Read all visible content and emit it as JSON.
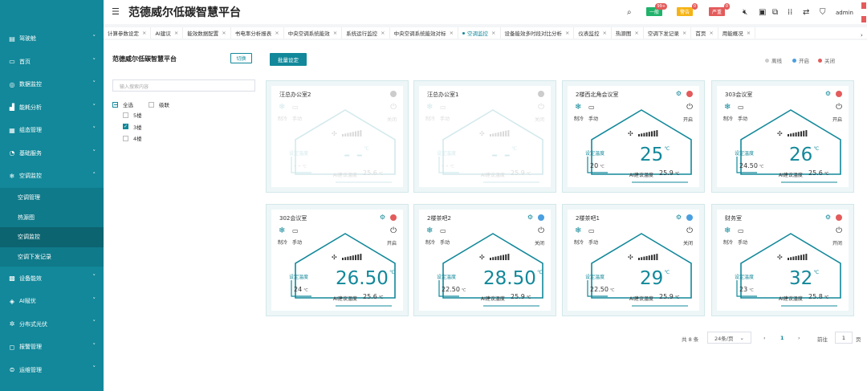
{
  "app_title": "范德威尔低碳智慧平台",
  "header": {
    "badges": [
      {
        "label": "一般",
        "count": "99+",
        "color": "#20b26a"
      },
      {
        "label": "警告",
        "count": "0",
        "color": "#f5b316"
      },
      {
        "label": "严重",
        "count": "0",
        "color": "#e35b5b"
      }
    ],
    "user": "admin"
  },
  "sidebar": {
    "items": [
      {
        "label": "驾驶舱",
        "icon": "dashboard-icon"
      },
      {
        "label": "首页",
        "icon": "monitor-icon"
      },
      {
        "label": "数据监控",
        "icon": "target-icon"
      },
      {
        "label": "能耗分析",
        "icon": "chart-icon"
      },
      {
        "label": "组态管理",
        "icon": "grid-icon"
      },
      {
        "label": "基础服务",
        "icon": "pie-icon"
      },
      {
        "label": "空调监控",
        "icon": "snowflake-icon"
      }
    ],
    "sub_items": [
      {
        "label": "空调管理",
        "active": false
      },
      {
        "label": "热源图",
        "active": false
      },
      {
        "label": "空调监控",
        "active": true
      },
      {
        "label": "空调下发记录",
        "active": false
      }
    ],
    "items_after": [
      {
        "label": "设备能效",
        "icon": "device-icon"
      },
      {
        "label": "AI赋优",
        "icon": "ai-icon"
      },
      {
        "label": "分布式光伏",
        "icon": "solar-icon"
      },
      {
        "label": "报警管理",
        "icon": "alarm-icon"
      },
      {
        "label": "运维管理",
        "icon": "wrench-icon"
      }
    ]
  },
  "tabs": [
    {
      "label": "计算参数设定",
      "active": false
    },
    {
      "label": "AI建议",
      "active": false
    },
    {
      "label": "能效数据配置",
      "active": false
    },
    {
      "label": "书电率分析报表",
      "active": false
    },
    {
      "label": "中央空调系统能效",
      "active": false
    },
    {
      "label": "系统运行监控",
      "active": false
    },
    {
      "label": "中央空调系统能效对标",
      "active": false
    },
    {
      "label": "空调监控",
      "active": true
    },
    {
      "label": "设备能效多时段对比分析",
      "active": false
    },
    {
      "label": "仪表监控",
      "active": false
    },
    {
      "label": "热源图",
      "active": false
    },
    {
      "label": "空调下发记录",
      "active": false
    },
    {
      "label": "首页",
      "active": false
    },
    {
      "label": "用能概况",
      "active": false
    }
  ],
  "tree": {
    "title": "范德威尔低碳智慧平台",
    "switch_label": "切换",
    "search_placeholder": "输入搜索内容",
    "select_all": "全选",
    "cascade": "级联",
    "floors": [
      {
        "label": "5楼",
        "checked": false
      },
      {
        "label": "3楼",
        "checked": true
      },
      {
        "label": "4楼",
        "checked": false
      }
    ]
  },
  "toolbar": {
    "batch_label": "批量设定"
  },
  "legend": [
    {
      "label": "离线",
      "color": "#cccccc"
    },
    {
      "label": "开启",
      "color": "#4a9fe0"
    },
    {
      "label": "关闭",
      "color": "#e35b5b"
    }
  ],
  "cards": [
    {
      "name": "汪总办公室2",
      "online": false,
      "mode": "制冷",
      "hand": "手动",
      "power": "关闭",
      "status_color": "#cccccc",
      "set_label": "设定温度",
      "set_temp": "- -",
      "temp": "- -",
      "ai_label": "AI建议温度",
      "ai_temp": "25.6"
    },
    {
      "name": "汪总办公室1",
      "online": false,
      "mode": "制冷",
      "hand": "手动",
      "power": "关闭",
      "status_color": "#cccccc",
      "set_label": "设定温度",
      "set_temp": "- -",
      "temp": "- -",
      "ai_label": "AI建议温度",
      "ai_temp": "25.9"
    },
    {
      "name": "2楼西北角会议室",
      "online": true,
      "mode": "制冷",
      "hand": "手动",
      "power": "开启",
      "status_color": "#e35b5b",
      "set_label": "设定温度",
      "set_temp": "20",
      "temp": "25",
      "ai_label": "AI建议温度",
      "ai_temp": "25.9"
    },
    {
      "name": "303会议室",
      "online": true,
      "mode": "制冷",
      "hand": "手动",
      "power": "开启",
      "status_color": "#e35b5b",
      "set_label": "设定温度",
      "set_temp": "24.50",
      "temp": "26",
      "ai_label": "AI建议温度",
      "ai_temp": "25.6"
    },
    {
      "name": "302会议室",
      "online": true,
      "mode": "制冷",
      "hand": "手动",
      "power": "开启",
      "status_color": "#e35b5b",
      "set_label": "设定温度",
      "set_temp": "24",
      "temp": "26.50",
      "ai_label": "AI建议温度",
      "ai_temp": "25.6"
    },
    {
      "name": "2楼茶吧2",
      "online": true,
      "mode": "制冷",
      "hand": "手动",
      "power": "关闭",
      "status_color": "#4a9fe0",
      "set_label": "设定温度",
      "set_temp": "22.50",
      "temp": "28.50",
      "ai_label": "AI建议温度",
      "ai_temp": "25.9"
    },
    {
      "name": "2楼茶吧1",
      "online": true,
      "mode": "制冷",
      "hand": "手动",
      "power": "关闭",
      "status_color": "#4a9fe0",
      "set_label": "设定温度",
      "set_temp": "22.50",
      "temp": "29",
      "ai_label": "AI建议温度",
      "ai_temp": "25.9"
    },
    {
      "name": "财务室",
      "online": true,
      "mode": "制冷",
      "hand": "手动",
      "power": "开闭",
      "status_color": "#e35b5b",
      "set_label": "设定温度",
      "set_temp": "23",
      "temp": "32",
      "ai_label": "AI建议温度",
      "ai_temp": "25.8"
    }
  ],
  "temp_unit": "℃",
  "pager": {
    "total": "共 8 条",
    "size": "24条/页",
    "current": "1",
    "jump_label": "前往",
    "jump_value": "1",
    "page_suffix": "页"
  },
  "colors": {
    "primary": "#12889a",
    "sidebar": "#12889a"
  }
}
